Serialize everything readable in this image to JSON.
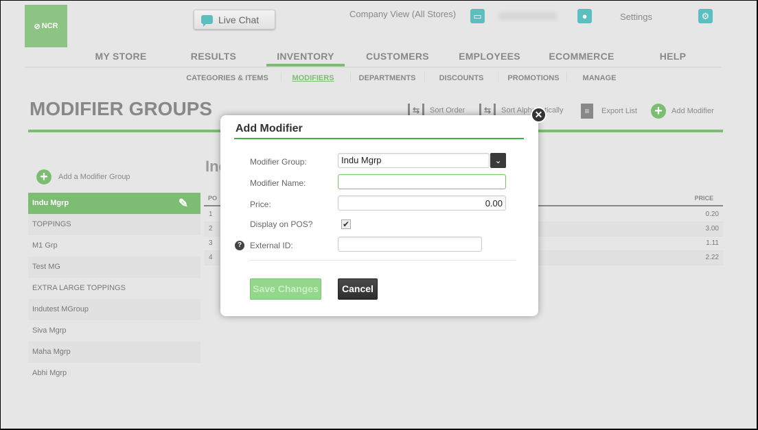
{
  "header": {
    "logo_text": "NCR",
    "live_chat": "Live Chat",
    "company_view": "Company View (All Stores)",
    "settings": "Settings"
  },
  "nav": [
    "MY STORE",
    "RESULTS",
    "INVENTORY",
    "CUSTOMERS",
    "EMPLOYEES",
    "ECOMMERCE",
    "HELP"
  ],
  "active_nav": "INVENTORY",
  "subnav": [
    "CATEGORIES & ITEMS",
    "MODIFIERS",
    "DEPARTMENTS",
    "DISCOUNTS",
    "PROMOTIONS",
    "MANAGE"
  ],
  "active_subnav": "MODIFIERS",
  "page_title": "MODIFIER GROUPS",
  "toolbar": {
    "sort_order": "Sort Order",
    "sort_alpha": "Sort Alphabetically",
    "export": "Export List",
    "add_modifier": "Add Modifier"
  },
  "sidebar": {
    "add_group": "Add a Modifier Group",
    "groups": [
      "Indu Mgrp",
      "TOPPINGS",
      "M1 Grp",
      "Test MG",
      "EXTRA LARGE TOPPINGS",
      "Indutest MGroup",
      "Siva Mgrp",
      "Maha Mgrp",
      "Abhi Mgrp"
    ]
  },
  "detail": {
    "title": "Indu Mgrp",
    "col_pos": "PO",
    "col_price": "PRICE",
    "rows": [
      {
        "pos": "1",
        "price": "0.20"
      },
      {
        "pos": "2",
        "price": "3.00"
      },
      {
        "pos": "3",
        "price": "1.11"
      },
      {
        "pos": "4",
        "price": "2.22"
      }
    ]
  },
  "modal": {
    "title": "Add Modifier",
    "group_label": "Modifier Group:",
    "group_value": "Indu Mgrp",
    "name_label": "Modifier Name:",
    "name_value": "",
    "price_label": "Price:",
    "price_value": "0.00",
    "display_label": "Display on POS?",
    "display_checked": true,
    "external_label": "External ID:",
    "external_value": "",
    "save": "Save Changes",
    "cancel": "Cancel"
  },
  "colors": {
    "brand_green": "#7dbd73",
    "teal": "#5bbfc0"
  }
}
